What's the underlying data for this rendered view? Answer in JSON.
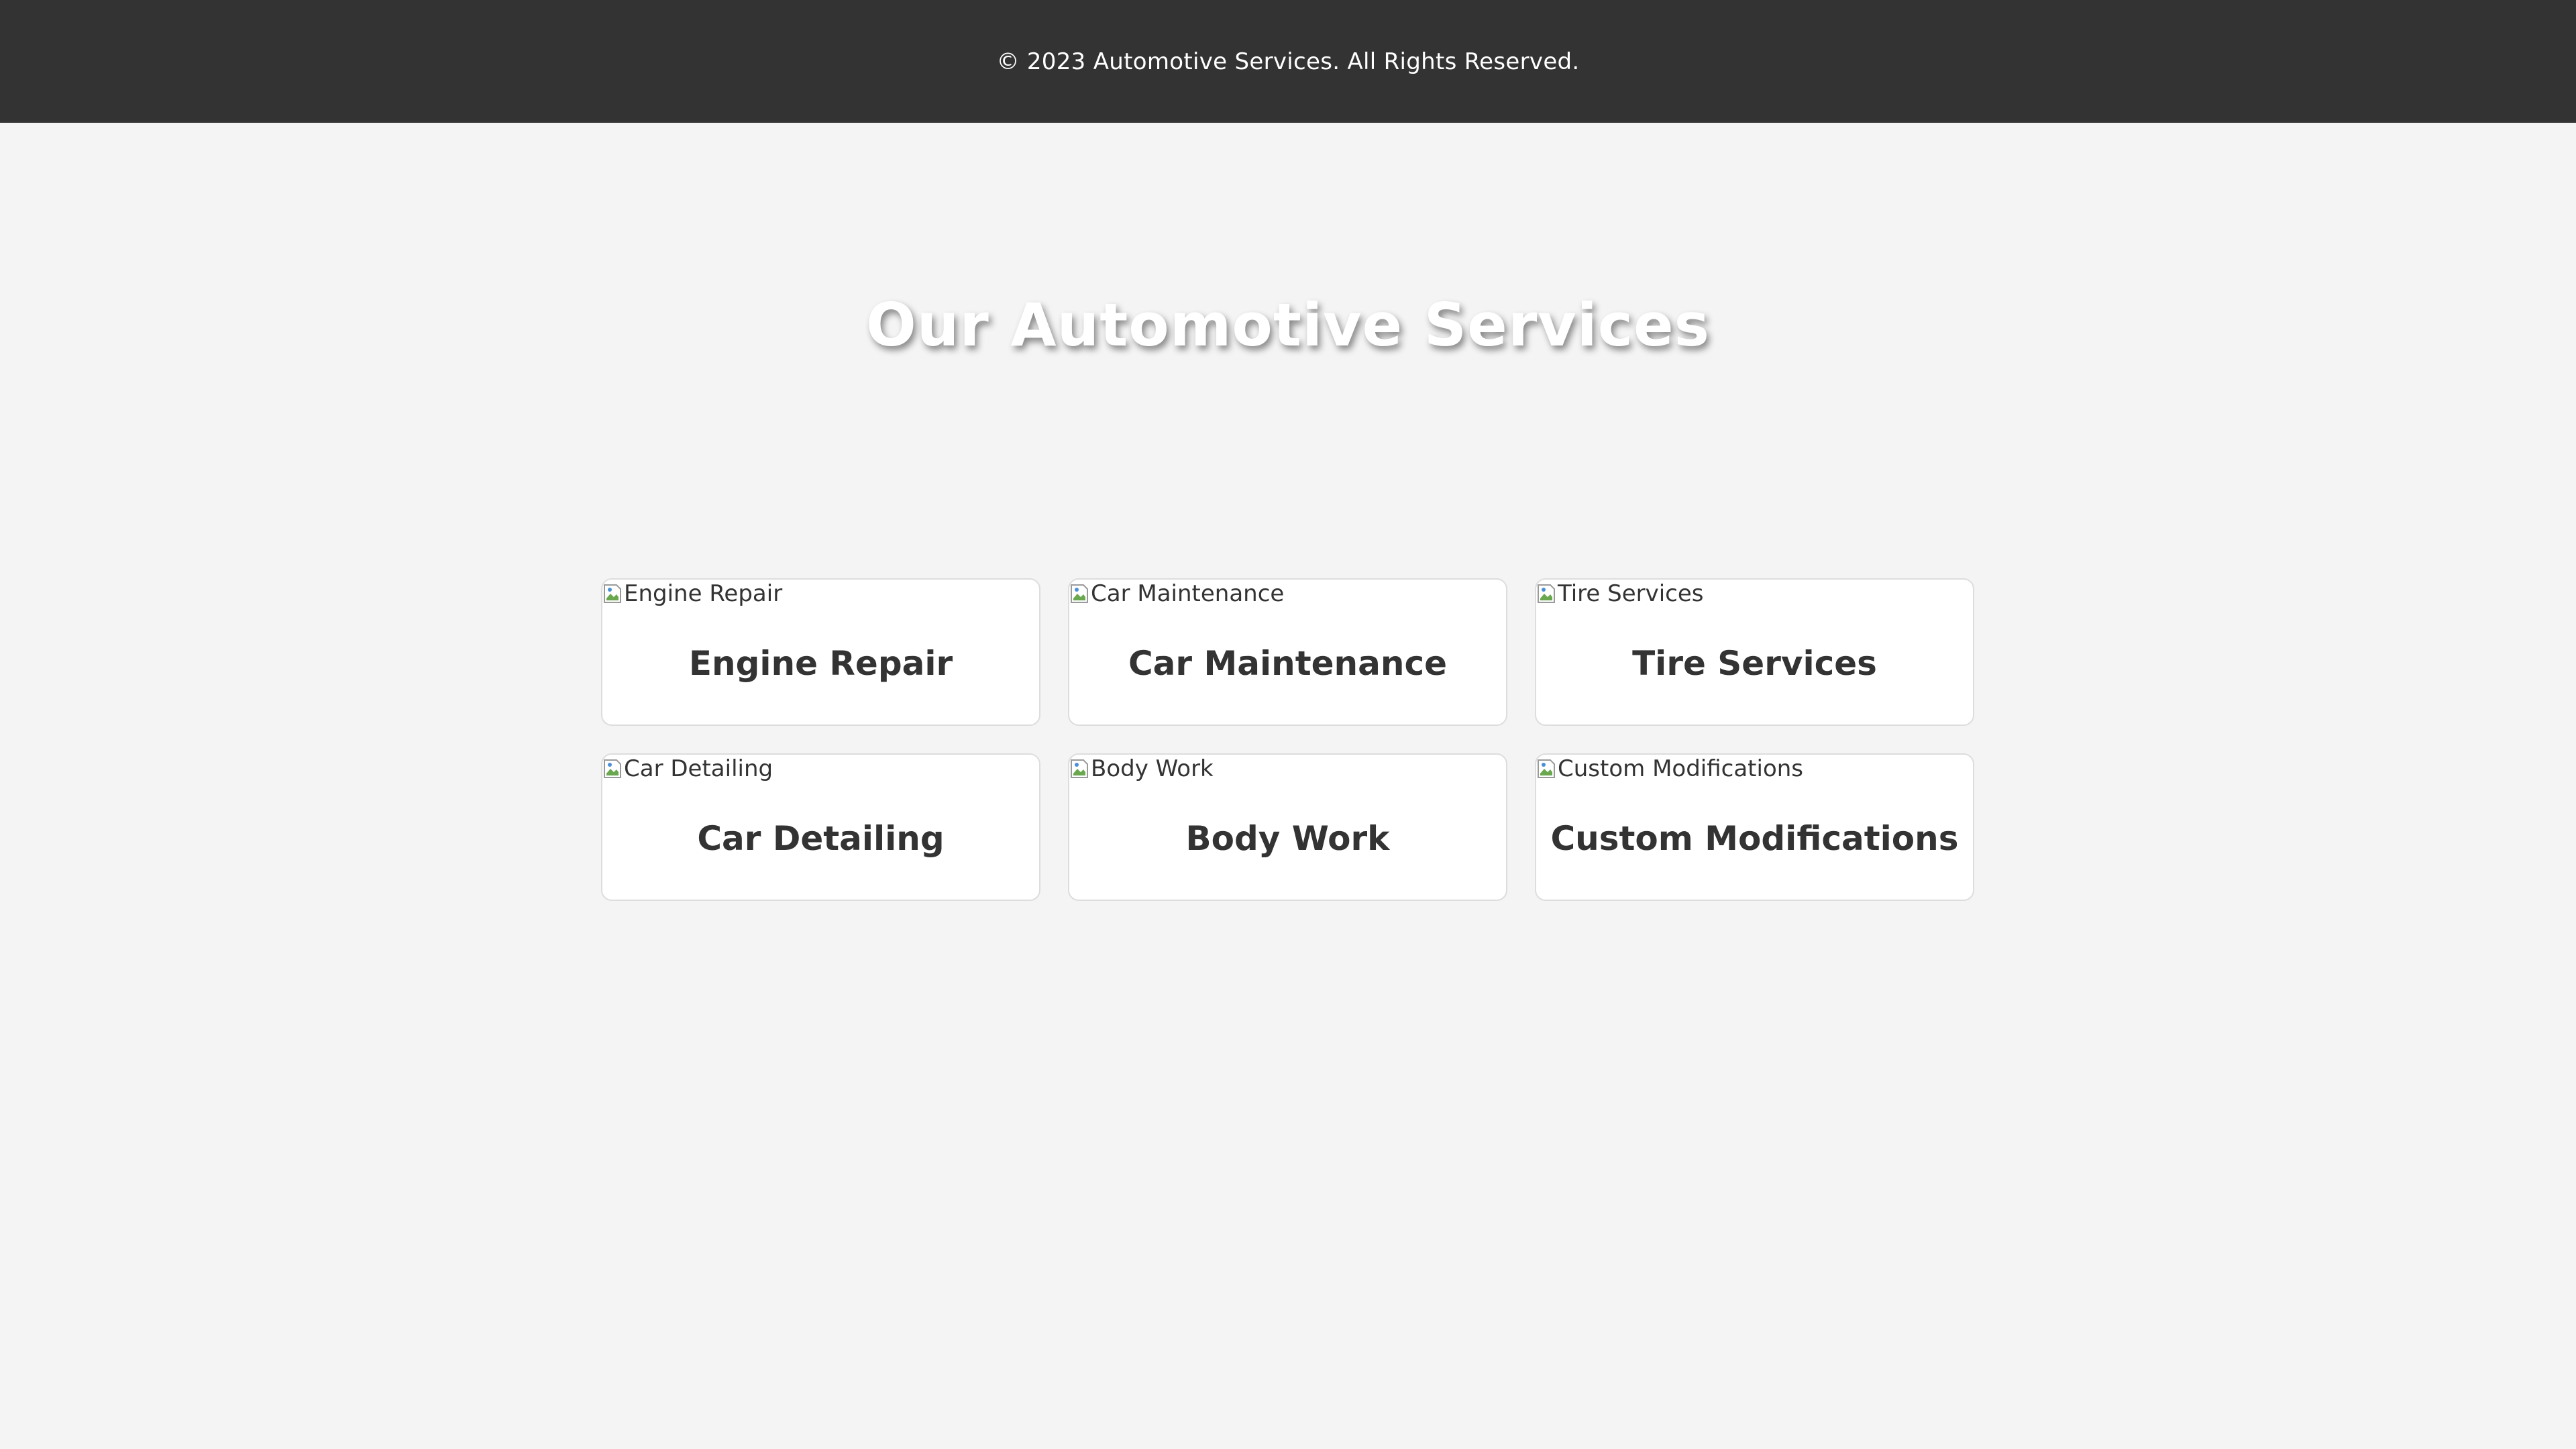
{
  "footer": {
    "copyright": "© 2023 Automotive Services. All Rights Reserved."
  },
  "main": {
    "title": "Our Automotive Services",
    "services": [
      {
        "title": "Engine Repair",
        "image_alt": "Engine Repair"
      },
      {
        "title": "Car Maintenance",
        "image_alt": "Car Maintenance"
      },
      {
        "title": "Tire Services",
        "image_alt": "Tire Services"
      },
      {
        "title": "Car Detailing",
        "image_alt": "Car Detailing"
      },
      {
        "title": "Body Work",
        "image_alt": "Body Work"
      },
      {
        "title": "Custom Modifications",
        "image_alt": "Custom Modifications"
      }
    ]
  },
  "colors": {
    "background": "#f4f4f4",
    "footer_bg": "#333333",
    "card_bg": "#ffffff",
    "text": "#333333"
  },
  "icons": {
    "image_placeholder": "broken-image-icon"
  }
}
